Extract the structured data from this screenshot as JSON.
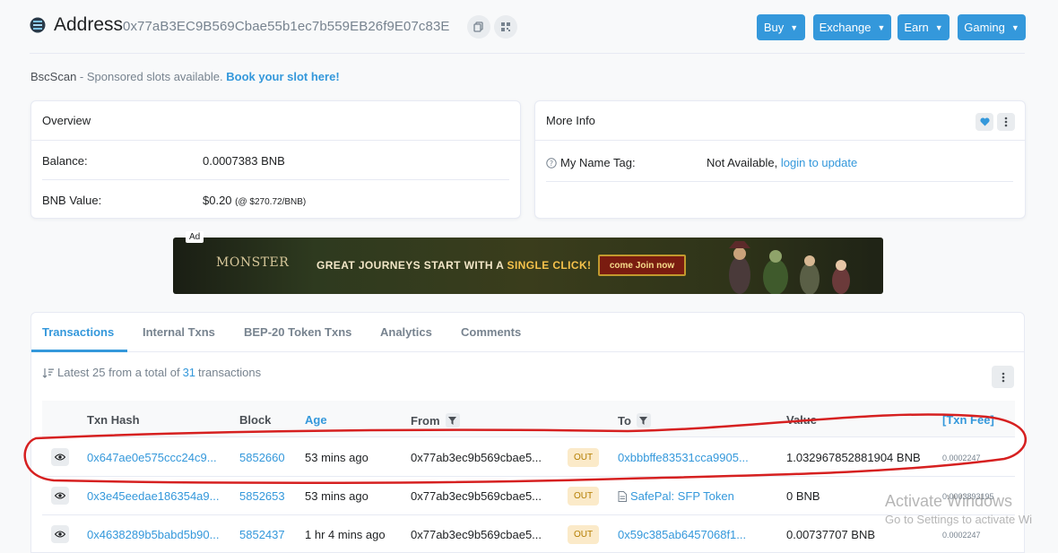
{
  "header": {
    "title": "Address",
    "address": "0x77aB3EC9B569Cbae55b1ec7b559EB26f9E07c83E",
    "nav": [
      {
        "label": "Buy"
      },
      {
        "label": "Exchange"
      },
      {
        "label": "Earn"
      },
      {
        "label": "Gaming"
      }
    ]
  },
  "sponsor": {
    "brand": "BscScan",
    "text": " - Sponsored slots available. ",
    "link": "Book your slot here!"
  },
  "overview": {
    "title": "Overview",
    "balance_label": "Balance:",
    "balance_value": "0.0007383 BNB",
    "value_label": "BNB Value:",
    "value_value": "$0.20",
    "value_rate": "(@ $270.72/BNB)"
  },
  "more_info": {
    "title": "More Info",
    "name_tag_label": "My Name Tag:",
    "name_tag_value": "Not Available, ",
    "name_tag_link": "login to update"
  },
  "ad": {
    "tag": "Ad",
    "logo": "MONSTER",
    "text_pre": "Great Journeys Start With a ",
    "text_accent": "Single Click!",
    "cta": "come Join now"
  },
  "tabs": [
    {
      "label": "Transactions"
    },
    {
      "label": "Internal Txns"
    },
    {
      "label": "BEP-20 Token Txns"
    },
    {
      "label": "Analytics"
    },
    {
      "label": "Comments"
    }
  ],
  "summary": {
    "pre": "Latest 25 from a total of ",
    "count": "31",
    "post": " transactions"
  },
  "table": {
    "headers": {
      "hash": "Txn Hash",
      "block": "Block",
      "age": "Age",
      "from": "From",
      "to": "To",
      "value": "Value",
      "fee": "[Txn Fee]"
    },
    "rows": [
      {
        "hash": "0x647ae0e575ccc24c9...",
        "block": "5852660",
        "age": "53 mins ago",
        "from": "0x77ab3ec9b569cbae5...",
        "dir": "OUT",
        "to": "0xbbbffe83531cca9905...",
        "value": "1.032967852881904 BNB",
        "fee": "0.0002247"
      },
      {
        "hash": "0x3e45eedae186354a9...",
        "block": "5852653",
        "age": "53 mins ago",
        "from": "0x77ab3ec9b569cbae5...",
        "dir": "OUT",
        "to": "SafePal: SFP Token",
        "value": "0 BNB",
        "fee": "0.0003893195"
      },
      {
        "hash": "0x4638289b5babd5b90...",
        "block": "5852437",
        "age": "1 hr 4 mins ago",
        "from": "0x77ab3ec9b569cbae5...",
        "dir": "OUT",
        "to": "0x59c385ab6457068f1...",
        "value": "0.00737707 BNB",
        "fee": "0.0002247"
      }
    ]
  },
  "watermark": {
    "line1": "Activate Windows",
    "line2": "Go to Settings to activate Wi"
  },
  "colors": {
    "accent": "#3498db",
    "annotation": "#d62020",
    "badge_bg": "#fbeac9"
  }
}
